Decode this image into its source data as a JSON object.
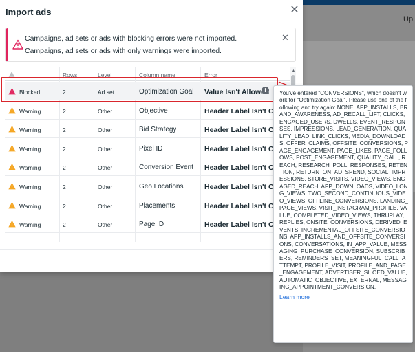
{
  "background": {
    "top_right_label": "Up"
  },
  "modal": {
    "title": "Import ads",
    "close_icon": "close-icon"
  },
  "banner": {
    "line1": "Campaigns, ad sets or ads with blocking errors were not imported.",
    "line2": "Campaigns, ad sets or ads with only warnings were imported.",
    "icon": "warning-triangle-icon",
    "accent": "#e0245e"
  },
  "table": {
    "headers": {
      "rows": "Rows",
      "level": "Level",
      "column_name": "Column name",
      "error": "Error"
    },
    "rows": [
      {
        "status": "Blocked",
        "rows": "2",
        "level": "Ad set",
        "column": "Optimization Goal",
        "error": "Value Isn't Allowed",
        "status_color": "#e0245e"
      },
      {
        "status": "Warning",
        "rows": "2",
        "level": "Other",
        "column": "Objective",
        "error": "Header Label Isn't Corre",
        "status_color": "#f5a623"
      },
      {
        "status": "Warning",
        "rows": "2",
        "level": "Other",
        "column": "Bid Strategy",
        "error": "Header Label Isn't Corre",
        "status_color": "#f5a623"
      },
      {
        "status": "Warning",
        "rows": "2",
        "level": "Other",
        "column": "Pixel ID",
        "error": "Header Label Isn't Corre",
        "status_color": "#f5a623"
      },
      {
        "status": "Warning",
        "rows": "2",
        "level": "Other",
        "column": "Conversion Event",
        "error": "Header Label Isn't Corre",
        "status_color": "#f5a623"
      },
      {
        "status": "Warning",
        "rows": "2",
        "level": "Other",
        "column": "Geo Locations",
        "error": "Header Label Isn't Corre",
        "status_color": "#f5a623"
      },
      {
        "status": "Warning",
        "rows": "2",
        "level": "Other",
        "column": "Placements",
        "error": "Header Label Isn't Corre",
        "status_color": "#f5a623"
      },
      {
        "status": "Warning",
        "rows": "2",
        "level": "Other",
        "column": "Page ID",
        "error": "Header Label Isn't Corre",
        "status_color": "#f5a623"
      }
    ]
  },
  "tooltip": {
    "text": "You've entered \"CONVERSIONS\", which doesn't work for \"Optimization Goal\". Please use one of the following and try again: NONE, APP_INSTALLS, BRAND_AWARENESS, AD_RECALL_LIFT, CLICKS, ENGAGED_USERS, DWELLS, EVENT_RESPONSES, IMPRESSIONS, LEAD_GENERATION, QUALITY_LEAD, LINK_CLICKS, MEDIA_DOWNLOADS, OFFER_CLAIMS, OFFSITE_CONVERSIONS, PAGE_ENGAGEMENT, PAGE_LIKES, PAGE_FOLLOWS, POST_ENGAGEMENT, QUALITY_CALL, REACH, RESEARCH_POLL_RESPONSES, RETENTION, RETURN_ON_AD_SPEND, SOCIAL_IMPRESSIONS, STORE_VISITS, VIDEO_VIEWS, ENGAGED_REACH, APP_DOWNLOADS, VIDEO_LONG_VIEWS, TWO_SECOND_CONTINUOUS_VIDEO_VIEWS, OFFLINE_CONVERSIONS, LANDING_PAGE_VIEWS, VISIT_INSTAGRAM_PROFILE, VALUE, COMPLETED_VIDEO_VIEWS, THRUPLAY, REPLIES, ONSITE_CONVERSIONS, DERIVED_EVENTS, INCREMENTAL_OFFSITE_CONVERSIONS, APP_INSTALLS_AND_OFFSITE_CONVERSIONS, CONVERSATIONS, IN_APP_VALUE, MESSAGING_PURCHASE_CONVERSION, SUBSCRIBERS, REMINDERS_SET, MEANINGFUL_CALL_ATTEMPT, PROFILE_VISIT, PROFILE_AND_PAGE_ENGAGEMENT, ADVERTISER_SILOED_VALUE, AUTOMATIC_OBJECTIVE, EXTERNAL, MESSAGING_APPOINTMENT_CONVERSION.",
    "link": "Learn more",
    "link_color": "#216fdb"
  },
  "highlight_color": "#d9262d"
}
